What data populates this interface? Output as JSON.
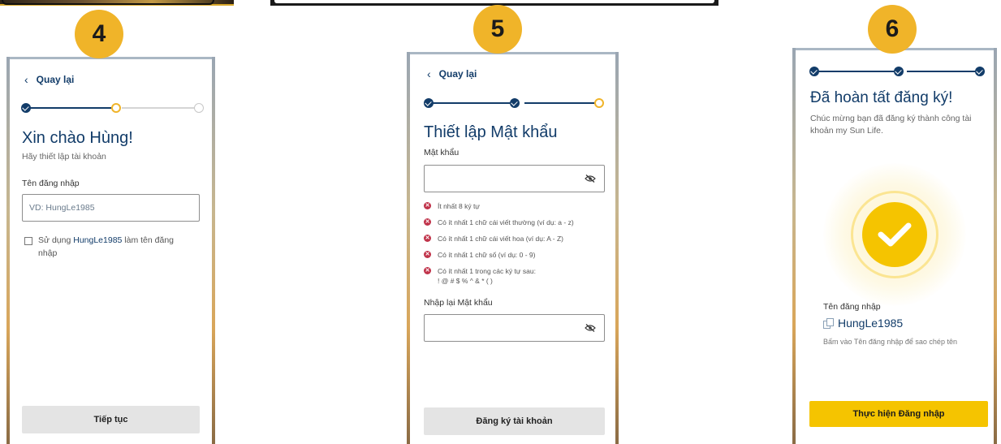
{
  "steps": {
    "step4": "4",
    "step5": "5",
    "step6": "6"
  },
  "colors": {
    "accent": "#f0b429",
    "brand_navy": "#123c69",
    "error": "#c0334a",
    "cta_yellow": "#f5c400"
  },
  "screen4": {
    "back_label": "Quay lại",
    "title": "Xin chào Hùng!",
    "subtitle": "Hãy thiết lập tài khoản",
    "username_label": "Tên đăng nhập",
    "username_placeholder": "VD: HungLe1985",
    "checkbox_prefix": "Sử dụng ",
    "checkbox_highlight": "HungLe1985",
    "checkbox_suffix": " làm tên đăng nhập",
    "continue_button": "Tiếp tục"
  },
  "screen5": {
    "back_label": "Quay lại",
    "title": "Thiết lập Mật khẩu",
    "password_label": "Mật khẩu",
    "password_icon": "eye-off-icon",
    "rules": [
      "Ít nhất 8 ký tự",
      "Có ít nhất 1 chữ cái viết thường (ví dụ: a - z)",
      "Có ít nhất 1 chữ cái viết hoa (ví dụ: A - Z)",
      "Có ít nhất 1 chữ số (ví dụ: 0 - 9)",
      "Có ít nhất 1 trong các ký tự sau:",
      "! @ # $ % ^ & * ( )"
    ],
    "confirm_label": "Nhập lại Mật khẩu",
    "register_button": "Đăng ký tài khoản"
  },
  "screen6": {
    "title": "Đã hoàn tất đăng ký!",
    "message": "Chúc mừng bạn đã đăng ký thành công tài khoản my Sun Life.",
    "username_label": "Tên đăng nhập",
    "username_value": "HungLe1985",
    "copy_hint": "Bấm vào Tên đăng nhập để sao chép tên",
    "login_button": "Thực hiện Đăng nhập"
  }
}
